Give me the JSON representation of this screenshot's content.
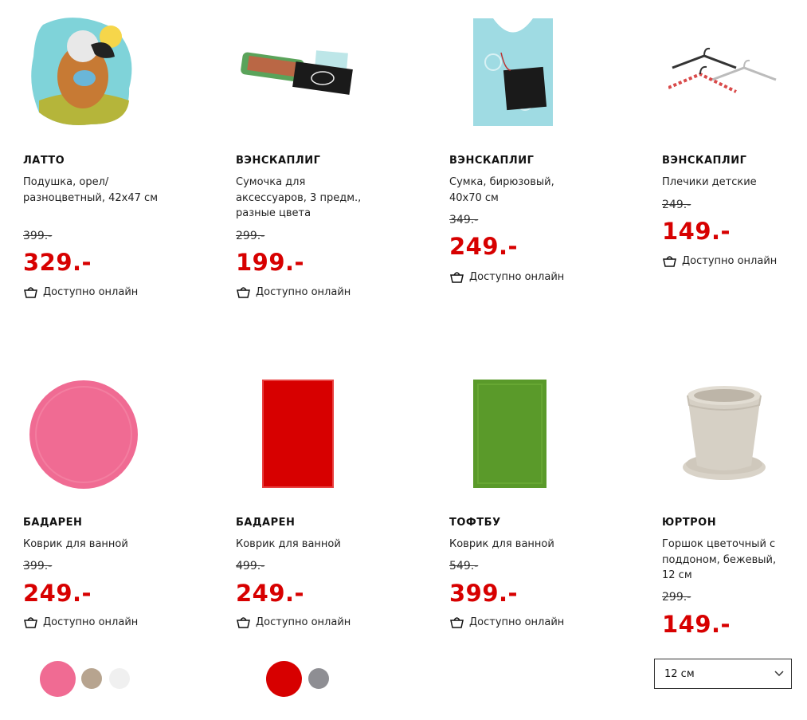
{
  "colors": {
    "price": "#d70000",
    "text": "#111111"
  },
  "products": [
    {
      "name": "ЛАТТО",
      "desc": "Подушка, орел/разноцветный, 42х47 см",
      "old_price": "399.-",
      "price": "329.-",
      "availability": "Доступно онлайн"
    },
    {
      "name": "ВЭНСКАПЛИГ",
      "desc": "Сумочка для аксессуаров, 3 предм., разные цвета",
      "old_price": "299.-",
      "price": "199.-",
      "availability": "Доступно онлайн"
    },
    {
      "name": "ВЭНСКАПЛИГ",
      "desc": "Сумка, бирюзовый, 40х70 см",
      "old_price": "349.-",
      "price": "249.-",
      "availability": "Доступно онлайн"
    },
    {
      "name": "ВЭНСКАПЛИГ",
      "desc": "Плечики детские",
      "old_price": "249.-",
      "price": "149.-",
      "availability": "Доступно онлайн"
    },
    {
      "name": "БАДАРЕН",
      "desc": "Коврик для ванной",
      "old_price": "399.-",
      "price": "249.-",
      "availability": "Доступно онлайн"
    },
    {
      "name": "БАДАРЕН",
      "desc": "Коврик для ванной",
      "old_price": "499.-",
      "price": "249.-",
      "availability": "Доступно онлайн"
    },
    {
      "name": "ТОФТБУ",
      "desc": "Коврик для ванной",
      "old_price": "549.-",
      "price": "399.-",
      "availability": "Доступно онлайн"
    },
    {
      "name": "ЮРТРОН",
      "desc": "Горшок цветочный с поддоном, бежевый, 12 см",
      "old_price": "299.-",
      "price": "149.-",
      "availability": ""
    }
  ],
  "swatches": {
    "product5": [
      "#f06b93",
      "#b7a48f",
      "#f0f0f0"
    ],
    "product6": [
      "#d70000",
      "#8e8e93"
    ]
  },
  "size_select": {
    "value": "12 см"
  }
}
